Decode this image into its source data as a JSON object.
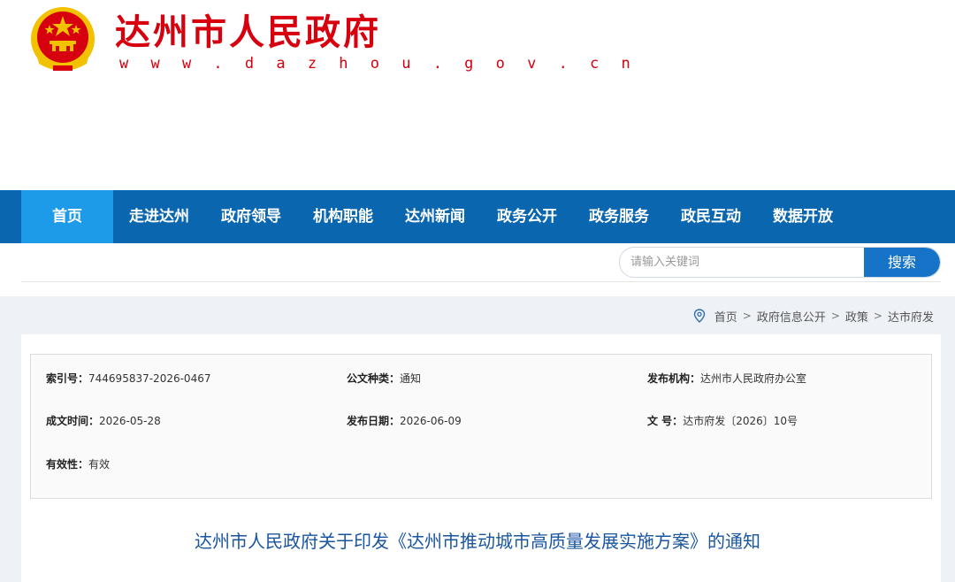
{
  "header": {
    "site_name": "达州市人民政府",
    "site_url": "w w w . d a z h o u . g o v . c n",
    "emblem_icon": "national-emblem-icon"
  },
  "nav": {
    "items": [
      {
        "label": "首页",
        "active": true
      },
      {
        "label": "走进达州"
      },
      {
        "label": "政府领导"
      },
      {
        "label": "机构职能"
      },
      {
        "label": "达州新闻"
      },
      {
        "label": "政务公开"
      },
      {
        "label": "政务服务"
      },
      {
        "label": "政民互动"
      },
      {
        "label": "数据开放"
      }
    ]
  },
  "search": {
    "placeholder": "请输入关键词",
    "button_label": "搜索"
  },
  "breadcrumb": {
    "icon": "location-pin-icon",
    "items": [
      "首页",
      "政府信息公开",
      "政策",
      "达市府发"
    ],
    "separator": ">"
  },
  "doc_info": {
    "index_no": {
      "label": "索引号：",
      "value": "744695837-2026-0467"
    },
    "doc_type": {
      "label": "公文种类：",
      "value": "通知"
    },
    "publisher": {
      "label": "发布机构：",
      "value": "达州市人民政府办公室"
    },
    "created_date": {
      "label": "成文时间：",
      "value": "2026-05-28"
    },
    "publish_date": {
      "label": "发布日期：",
      "value": "2026-06-09"
    },
    "doc_number": {
      "label": "文 号：",
      "value": "达市府发〔2026〕10号"
    },
    "validity": {
      "label": "有效性：",
      "value": "有效"
    }
  },
  "document": {
    "title": "达州市人民政府关于印发《达州市推动城市高质量发展实施方案》的通知"
  },
  "colors": {
    "brand_red": "#d7000f",
    "nav_blue": "#0b66b0",
    "nav_active": "#1e9be8",
    "title_blue": "#1a56a0"
  }
}
